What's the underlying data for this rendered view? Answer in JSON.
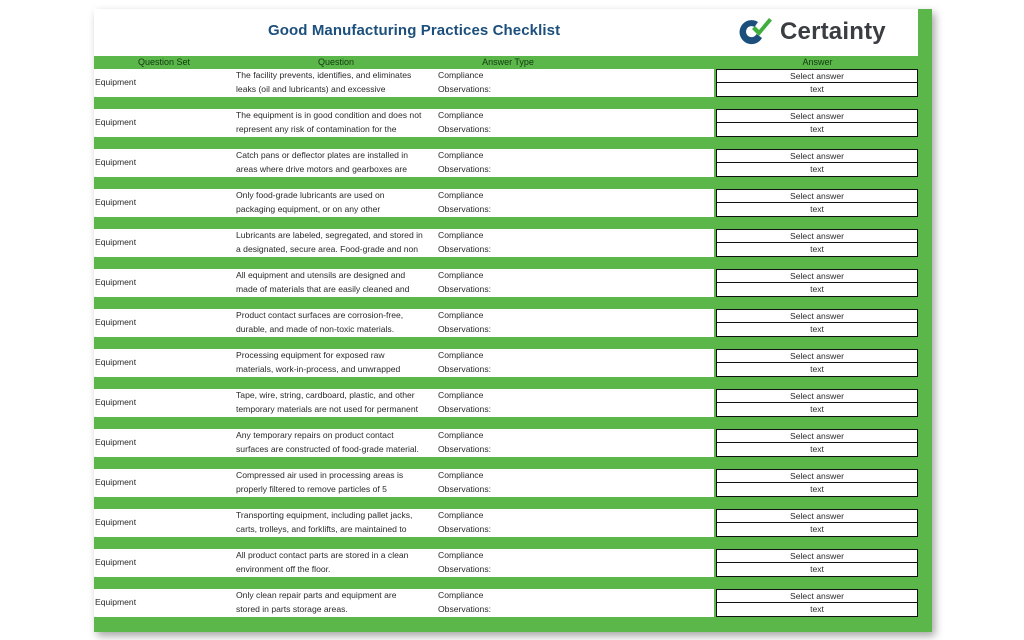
{
  "header": {
    "title": "Good Manufacturing Practices Checklist",
    "logo_text": "Certainty",
    "brand_colors": {
      "green": "#5bb74a",
      "blue": "#1c4f7c",
      "check_green": "#3fae3c"
    }
  },
  "columns": {
    "question_set": "Question Set",
    "question": "Question",
    "answer_type": "Answer Type",
    "answer": "Answer"
  },
  "rows": [
    {
      "question_set": "Equipment",
      "question_line1": "The facility prevents, identifies, and eliminates",
      "question_line2": "leaks (oil and lubricants) and excessive",
      "type_line1": "Compliance",
      "type_line2": "Observations:",
      "answer_select": "Select answer",
      "answer_text": "text"
    },
    {
      "question_set": "Equipment",
      "question_line1": "The equipment is in good condition and does not",
      "question_line2": "represent any risk of contamination for the",
      "type_line1": "Compliance",
      "type_line2": "Observations:",
      "answer_select": "Select answer",
      "answer_text": "text"
    },
    {
      "question_set": "Equipment",
      "question_line1": "Catch pans or deflector plates are installed in",
      "question_line2": "areas where drive motors and gearboxes are",
      "type_line1": "Compliance",
      "type_line2": "Observations:",
      "answer_select": "Select answer",
      "answer_text": "text"
    },
    {
      "question_set": "Equipment",
      "question_line1": "Only food-grade lubricants are used on",
      "question_line2": "packaging equipment, or on any other",
      "type_line1": "Compliance",
      "type_line2": "Observations:",
      "answer_select": "Select answer",
      "answer_text": "text"
    },
    {
      "question_set": "Equipment",
      "question_line1": "Lubricants are labeled, segregated, and stored in",
      "question_line2": "a designated, secure area. Food-grade and non",
      "type_line1": "Compliance",
      "type_line2": "Observations:",
      "answer_select": "Select answer",
      "answer_text": "text"
    },
    {
      "question_set": "Equipment",
      "question_line1": "All equipment and utensils are designed and",
      "question_line2": "made of materials that are easily cleaned and",
      "type_line1": "Compliance",
      "type_line2": "Observations:",
      "answer_select": "Select answer",
      "answer_text": "text"
    },
    {
      "question_set": "Equipment",
      "question_line1": "Product contact surfaces are corrosion-free,",
      "question_line2": "durable, and made of non-toxic materials.",
      "type_line1": "Compliance",
      "type_line2": "Observations:",
      "answer_select": "Select answer",
      "answer_text": "text"
    },
    {
      "question_set": "Equipment",
      "question_line1": "Processing equipment for exposed raw",
      "question_line2": "materials, work-in-process, and unwrapped",
      "type_line1": "Compliance",
      "type_line2": "Observations:",
      "answer_select": "Select answer",
      "answer_text": "text"
    },
    {
      "question_set": "Equipment",
      "question_line1": "Tape, wire, string, cardboard, plastic, and other",
      "question_line2": "temporary materials are not used for permanent",
      "type_line1": "Compliance",
      "type_line2": "Observations:",
      "answer_select": "Select answer",
      "answer_text": "text"
    },
    {
      "question_set": "Equipment",
      "question_line1": "Any temporary repairs on product contact",
      "question_line2": "surfaces are constructed of food-grade material.",
      "type_line1": "Compliance",
      "type_line2": "Observations:",
      "answer_select": "Select answer",
      "answer_text": "text"
    },
    {
      "question_set": "Equipment",
      "question_line1": "Compressed air used in processing areas is",
      "question_line2": "properly filtered to remove particles of 5",
      "type_line1": "Compliance",
      "type_line2": "Observations:",
      "answer_select": "Select answer",
      "answer_text": "text"
    },
    {
      "question_set": "Equipment",
      "question_line1": "Transporting equipment, including pallet jacks,",
      "question_line2": "carts, trolleys, and forklifts, are maintained to",
      "type_line1": "Compliance",
      "type_line2": "Observations:",
      "answer_select": "Select answer",
      "answer_text": "text"
    },
    {
      "question_set": "Equipment",
      "question_line1": "All product contact parts are stored in a clean",
      "question_line2": "environment off the floor.",
      "type_line1": "Compliance",
      "type_line2": "Observations:",
      "answer_select": "Select answer",
      "answer_text": "text"
    },
    {
      "question_set": "Equipment",
      "question_line1": "Only clean repair parts and equipment are",
      "question_line2": "stored in parts storage areas.",
      "type_line1": "Compliance",
      "type_line2": "Observations:",
      "answer_select": "Select answer",
      "answer_text": "text"
    }
  ]
}
